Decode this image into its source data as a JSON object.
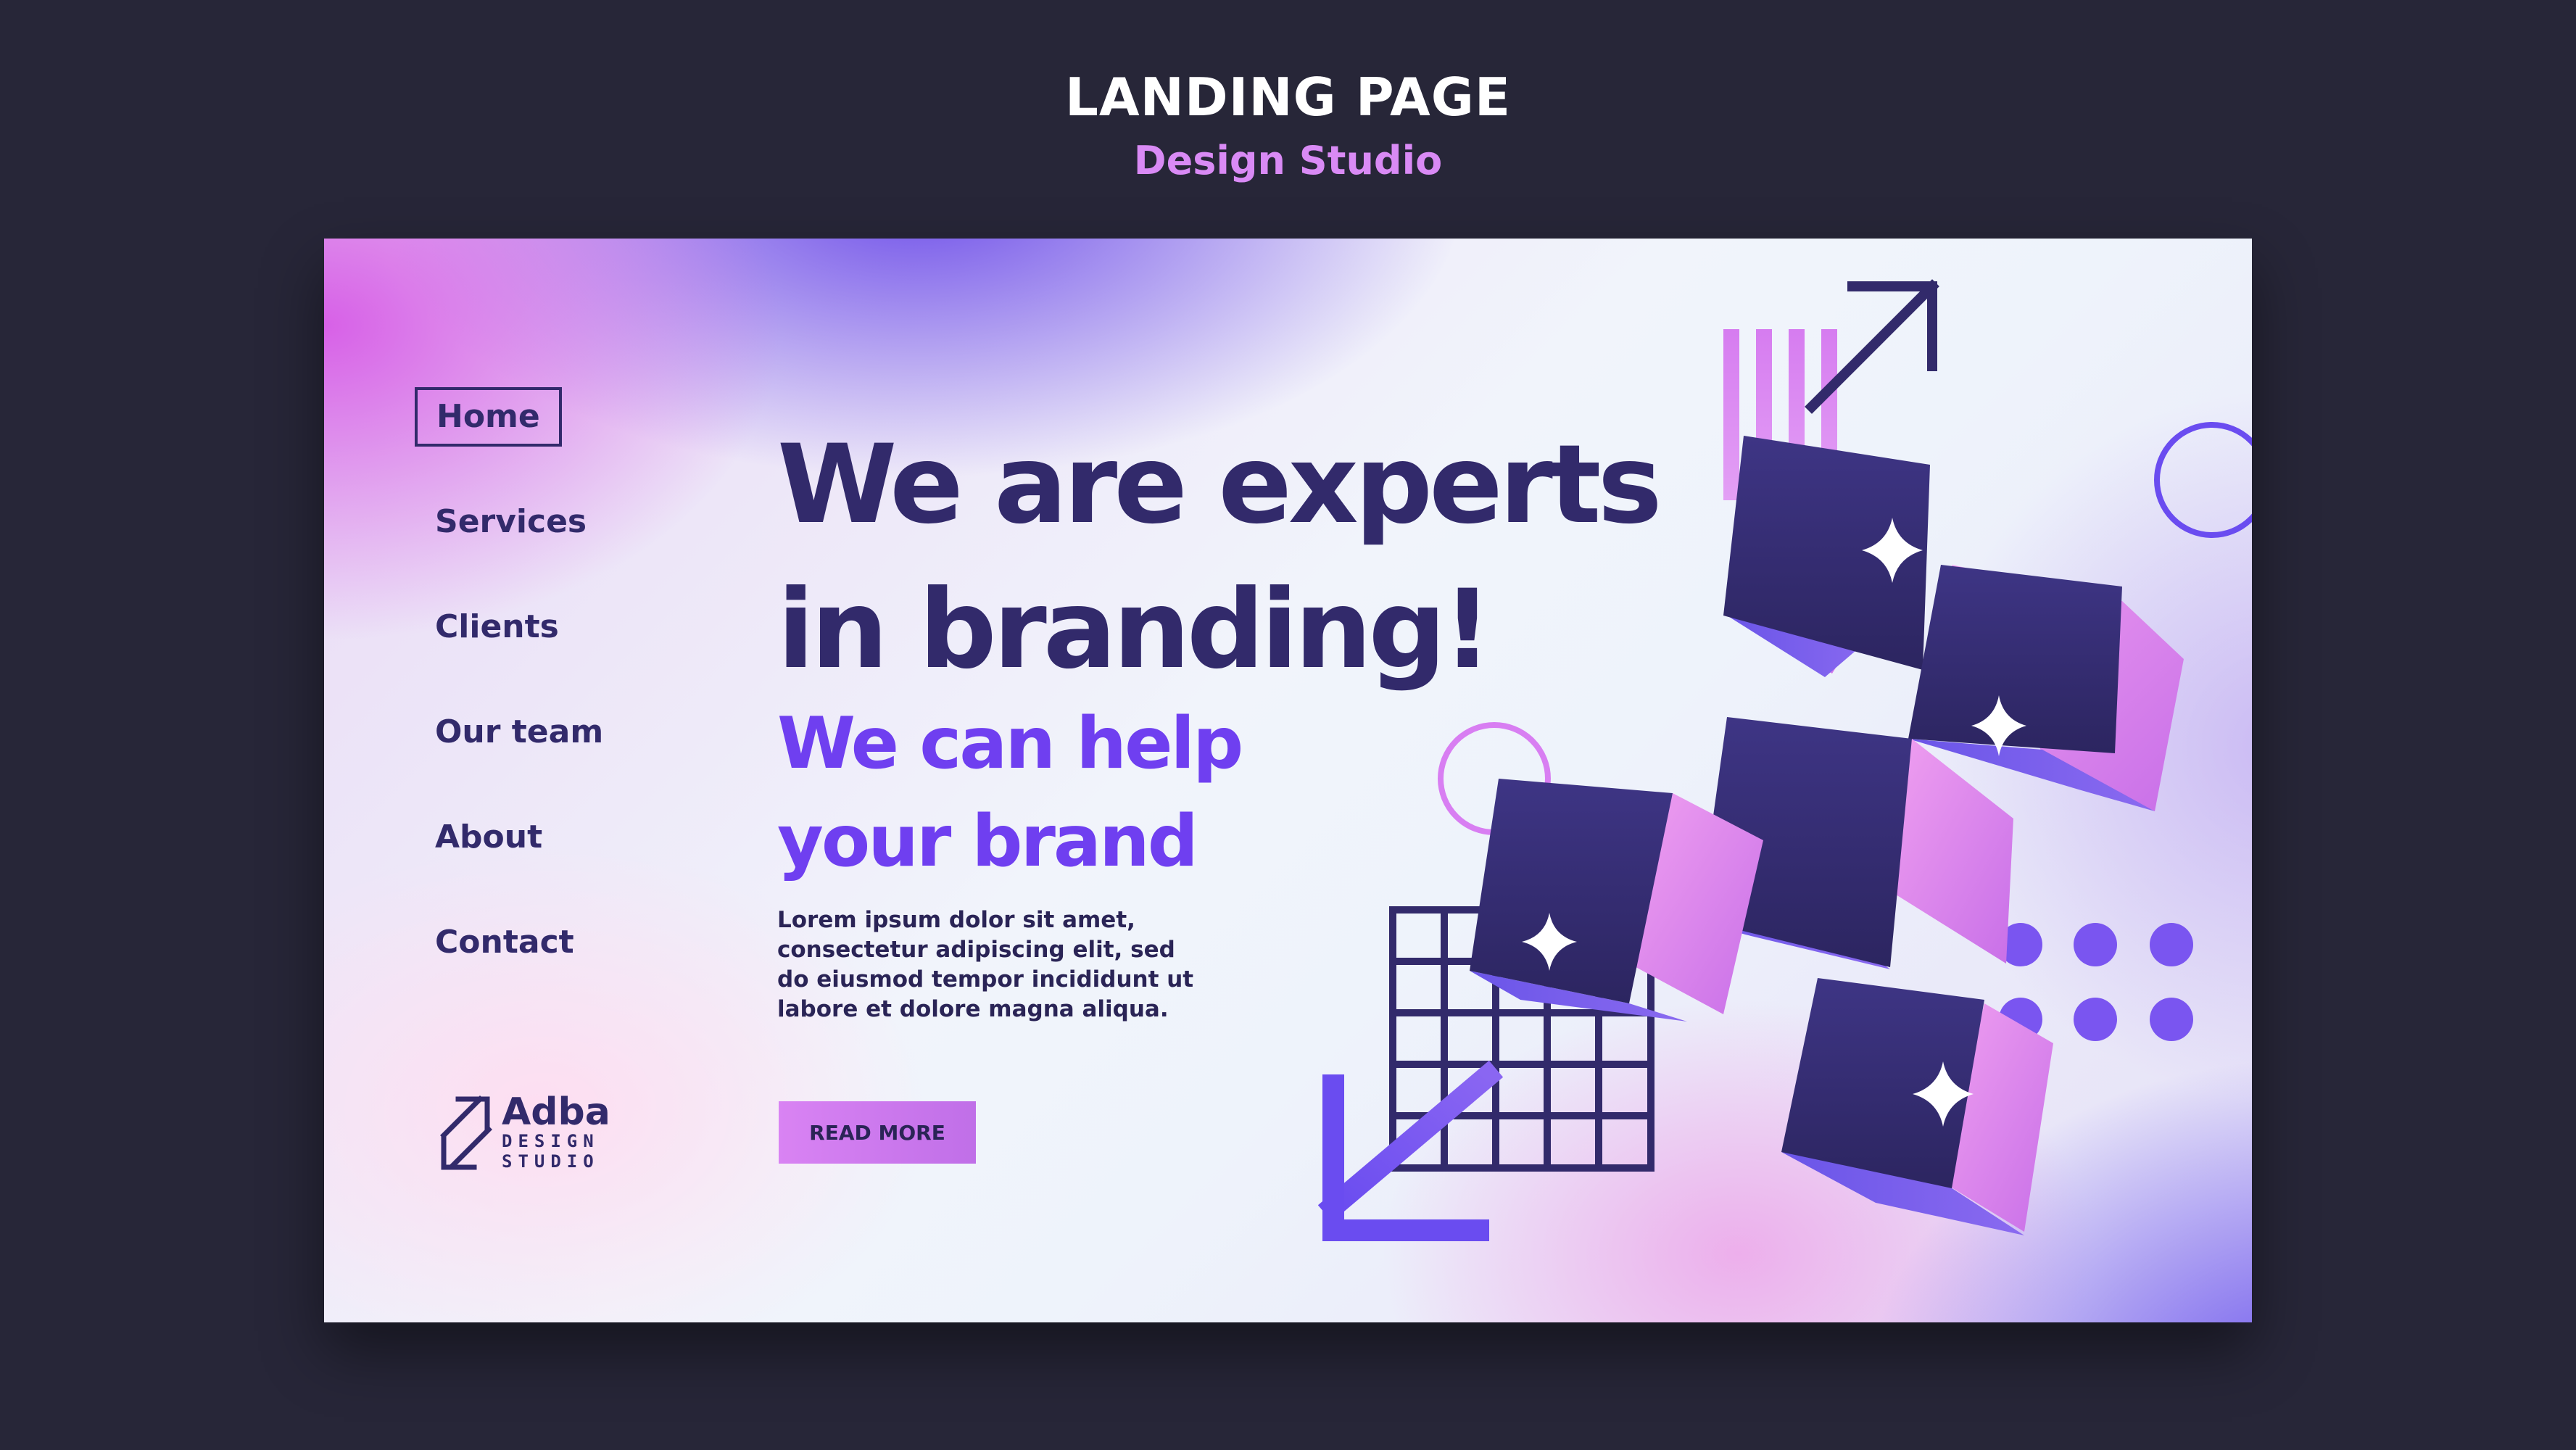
{
  "header": {
    "title": "LANDING PAGE",
    "subtitle": "Design Studio"
  },
  "nav": {
    "items": [
      {
        "label": "Home",
        "active": true
      },
      {
        "label": "Services",
        "active": false
      },
      {
        "label": "Clients",
        "active": false
      },
      {
        "label": "Our team",
        "active": false
      },
      {
        "label": "About",
        "active": false
      },
      {
        "label": "Contact",
        "active": false
      }
    ]
  },
  "logo": {
    "name": "Adba",
    "sub_line1": "DESIGN",
    "sub_line2": "STUDIO"
  },
  "hero": {
    "headline_line1": "We are experts",
    "headline_line2": "in branding!",
    "subhead_line1": "We can help",
    "subhead_line2": "your brand",
    "body_line1": "Lorem ipsum dolor sit amet,",
    "body_line2": "consectetur adipiscing elit, sed",
    "body_line3": "do eiusmod tempor incididunt ut",
    "body_line4": "labore et dolore magna aliqua.",
    "cta_label": "READ MORE"
  },
  "colors": {
    "background": "#272638",
    "navy": "#322a6b",
    "purple": "#6f3ff0",
    "pink": "#d98af5"
  }
}
